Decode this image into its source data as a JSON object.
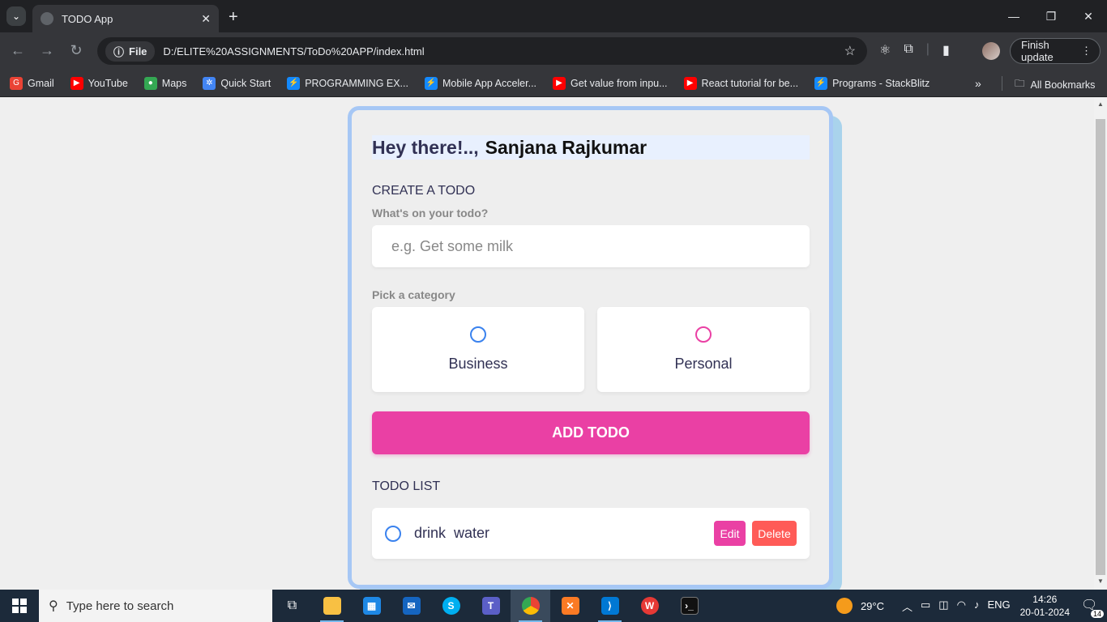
{
  "browser": {
    "tab_title": "TODO App",
    "address_chip": "File",
    "url": "D:/ELITE%20ASSIGNMENTS/ToDo%20APP/index.html",
    "finish_update": "Finish update",
    "bookmarks": [
      {
        "label": "Gmail",
        "icon": "gmail-icon",
        "color": "#ea4335"
      },
      {
        "label": "YouTube",
        "icon": "youtube-icon",
        "color": "#ff0000"
      },
      {
        "label": "Maps",
        "icon": "maps-icon",
        "color": "#34a853"
      },
      {
        "label": "Quick Start",
        "icon": "gear-icon",
        "color": "#4285f4"
      },
      {
        "label": "PROGRAMMING EX...",
        "icon": "bolt-icon",
        "color": "#1389fd"
      },
      {
        "label": "Mobile App Acceler...",
        "icon": "bolt-icon",
        "color": "#1389fd"
      },
      {
        "label": "Get value from inpu...",
        "icon": "youtube-icon",
        "color": "#ff0000"
      },
      {
        "label": "React tutorial for be...",
        "icon": "youtube-icon",
        "color": "#ff0000"
      },
      {
        "label": "Programs - StackBlitz",
        "icon": "bolt-icon",
        "color": "#1389fd"
      }
    ],
    "all_bookmarks": "All Bookmarks"
  },
  "app": {
    "greeting": "Hey there!..,",
    "user_name": "Sanjana Rajkumar",
    "create_heading": "CREATE A TODO",
    "todo_label": "What's on your todo?",
    "todo_placeholder": "e.g. Get some milk",
    "todo_value": "",
    "category_label": "Pick a category",
    "categories": [
      {
        "label": "Business",
        "color": "#3a82ee"
      },
      {
        "label": "Personal",
        "color": "#ea40a4"
      }
    ],
    "add_button": "ADD TODO",
    "list_heading": "TODO LIST",
    "todos": [
      {
        "text": "drink  water",
        "edit_label": "Edit",
        "delete_label": "Delete"
      }
    ]
  },
  "taskbar": {
    "search_placeholder": "Type here to search",
    "weather": "29°C",
    "language": "ENG",
    "time": "14:26",
    "date": "20-01-2024",
    "notifications": "14"
  }
}
